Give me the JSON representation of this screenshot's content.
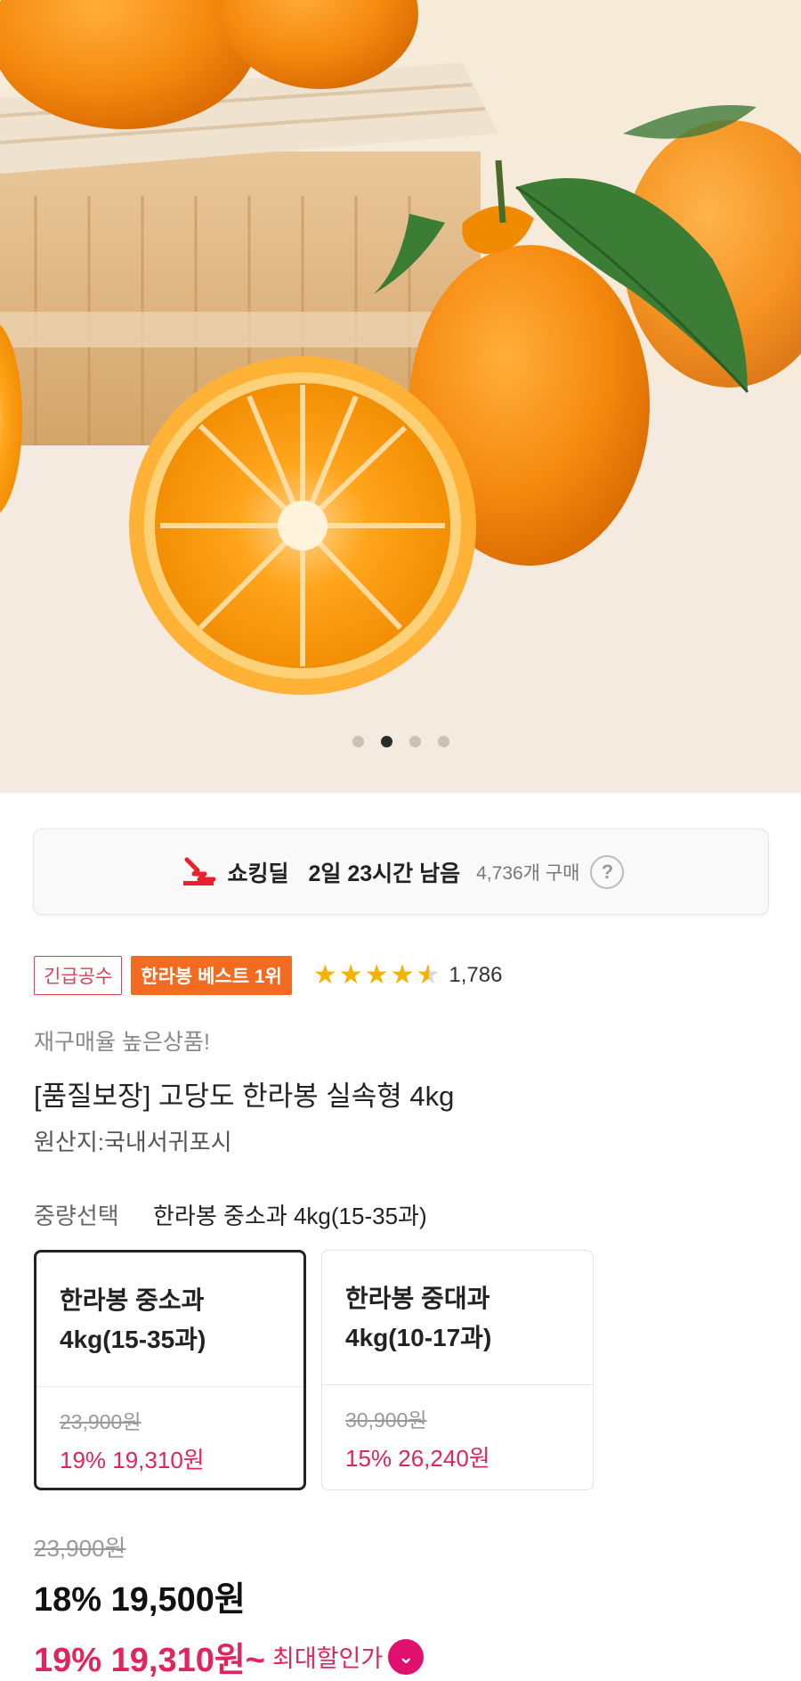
{
  "carousel": {
    "dot_count": 4,
    "active_index": 1
  },
  "deal": {
    "brand": "쇼킹딜",
    "time_left": "2일 23시간 남음",
    "purchase_count": "4,736개 구매",
    "help_symbol": "?"
  },
  "badges": {
    "urgent": "긴급공수",
    "best": "한라봉 베스트 1위"
  },
  "rating": {
    "stars": 4.5,
    "count": "1,786"
  },
  "product": {
    "subtitle": "재구매율 높은상품!",
    "title": "[품질보장] 고당도 한라봉 실속형 4kg",
    "origin": "원산지:국내서귀포시"
  },
  "weight_option": {
    "label": "중량선택",
    "selected": "한라봉 중소과 4kg(15-35과)",
    "options": [
      {
        "name_line1": "한라봉 중소과",
        "name_line2": "4kg(15-35과)",
        "original": "23,900원",
        "sale": "19% 19,310원",
        "selected": true
      },
      {
        "name_line1": "한라봉 중대과",
        "name_line2": "4kg(10-17과)",
        "original": "30,900원",
        "sale": "15% 26,240원",
        "selected": false
      }
    ]
  },
  "pricing": {
    "original": "23,900원",
    "current": "18% 19,500원",
    "max_discount_price": "19% 19,310원~",
    "max_discount_label": "최대할인가"
  },
  "colors": {
    "accent": "#e0245e",
    "badge_orange": "#f36b21",
    "star": "#f5b301"
  }
}
